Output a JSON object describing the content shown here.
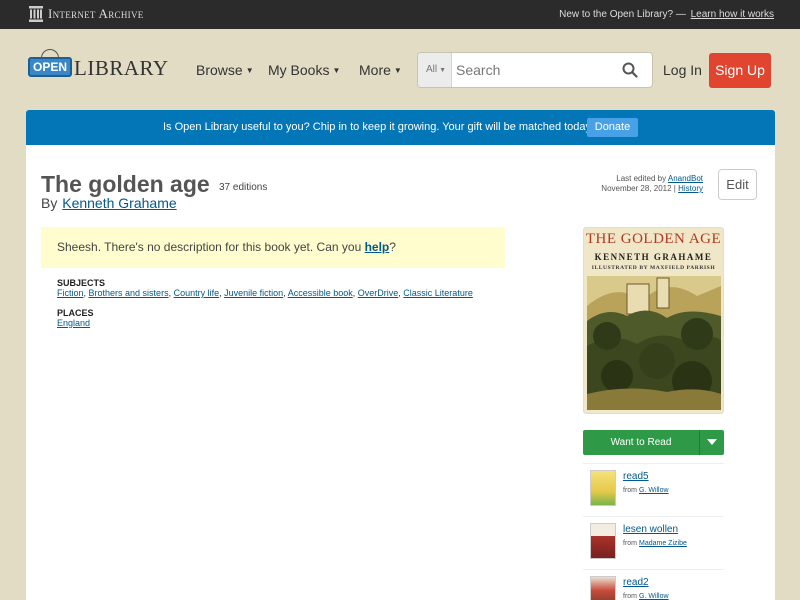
{
  "ia_bar": {
    "logo_text": "Internet Archive",
    "prompt": "New to the Open Library? —",
    "learn_link": "Learn how it works"
  },
  "header": {
    "logo_sign": "OPEN",
    "logo_word": "LIBRARY",
    "nav": [
      "Browse",
      "My Books",
      "More"
    ],
    "search_scope": "All",
    "search_placeholder": "Search",
    "login": "Log In",
    "signup": "Sign Up"
  },
  "donate": {
    "message": "Is Open Library useful to you? Chip in to keep it growing. Your gift will be matched today!",
    "button": "Donate"
  },
  "book": {
    "title": "The golden age",
    "editions": "37 editions",
    "by_label": "By",
    "author": "Kenneth Grahame",
    "last_edited_label": "Last edited by",
    "last_edited_user": "AnandBot",
    "last_edited_date": "November 28, 2012 |",
    "history_link": "History",
    "edit_button": "Edit",
    "description_text": "Sheesh. There's no description for this book yet. Can you",
    "description_help": "help",
    "description_end": "?"
  },
  "subjects": {
    "heading": "Subjects",
    "items": [
      "Fiction",
      "Brothers and sisters",
      "Country life",
      "Juvenile fiction",
      "Accessible book",
      "OverDrive",
      "Classic Literature"
    ]
  },
  "places": {
    "heading": "Places",
    "items": [
      "England"
    ]
  },
  "cover": {
    "title": "THE GOLDEN AGE",
    "author": "KENNETH GRAHAME",
    "illustrator": "ILLUSTRATED BY MAXFIELD PARRISH"
  },
  "want_to_read": "Want to Read",
  "lists": [
    {
      "name": "read5",
      "from_label": "from",
      "owner": "G. Willow"
    },
    {
      "name": "lesen wollen",
      "from_label": "from",
      "owner": "Madame Zizibe"
    },
    {
      "name": "read2",
      "from_label": "from",
      "owner": "G. Willow"
    }
  ],
  "colors": {
    "ia_bar": "#2b2b2b",
    "page_bg": "#e2dcc5",
    "donate_bar": "#0376b8",
    "signup": "#e1452f",
    "want_to_read": "#2e9a48",
    "link": "#02598b"
  }
}
